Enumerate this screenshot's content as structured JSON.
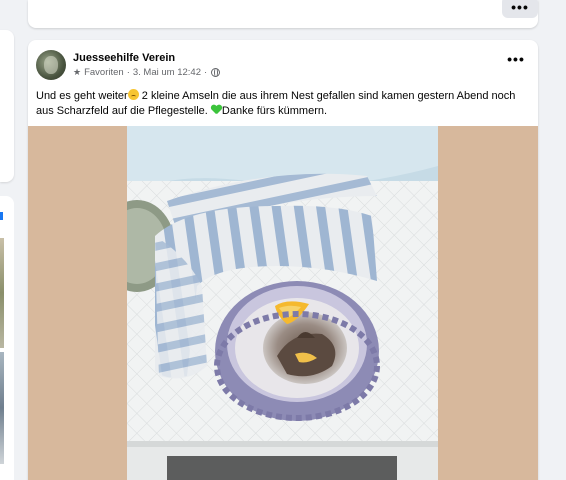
{
  "feed": {
    "previous_post_more": "•••"
  },
  "post": {
    "author": "Juesseehilfe Verein",
    "audience_label": "Favoriten",
    "separator": "·",
    "timestamp": "3. Mai um 12:42",
    "more_label": "•••",
    "text_part1": "Und es geht weiter",
    "text_part2": " 2 kleine  Amseln  die aus ihrem Nest gefallen sind kamen gestern Abend noch aus Scharzfeld auf die Pflegestelle. ",
    "text_part3": "Danke fürs kümmern.",
    "photo_backdrop_color": "#d7b89c"
  }
}
